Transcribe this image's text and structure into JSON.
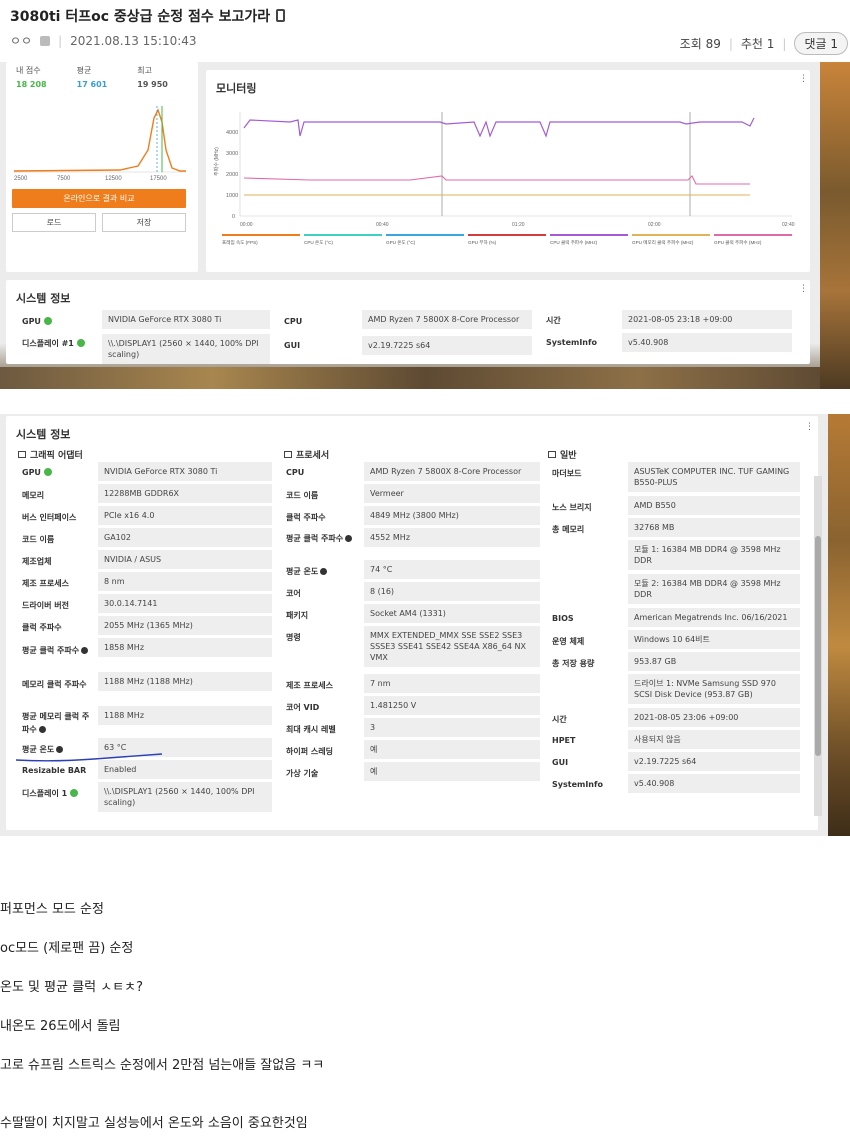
{
  "post": {
    "title": "3080ti 터프oc 중상급 순정 점수 보고가라",
    "author": "ㅇㅇ",
    "datetime": "2021.08.13 15:10:43",
    "views": "조회 89",
    "likes": "추천 1",
    "comments": "댓글 1"
  },
  "shot1": {
    "score_labels": [
      "내 점수",
      "평균",
      "최고"
    ],
    "score_values": [
      "18 208",
      "17 601",
      "19 950"
    ],
    "score_colors": [
      "#49b649",
      "#3a9bd9",
      "#222222"
    ],
    "hist_ticks": [
      "2500",
      "7500",
      "12500",
      "17500"
    ],
    "compare_button": "온라인으로 결과 비교",
    "load_button": "로드",
    "save_button": "저장",
    "monitoring_title": "모니터링",
    "y_axis_label": "주파수 (MHz)",
    "y_ticks": [
      "4000",
      "3000",
      "2000",
      "1000",
      "0"
    ],
    "x_ticks": [
      "00:00",
      "00:40",
      "01:20",
      "02:00",
      "02:40"
    ],
    "legend": [
      {
        "label": "프레임 속도 (FPS)",
        "color": "#f07d1c"
      },
      {
        "label": "CPU 온도 (°C)",
        "color": "#3ed0c5"
      },
      {
        "label": "GPU 온도 (°C)",
        "color": "#3aa6e0"
      },
      {
        "label": "GPU 부하 (%)",
        "color": "#d23c3c"
      },
      {
        "label": "CPU 클럭 주파수 (MHz)",
        "color": "#a35cd6"
      },
      {
        "label": "GPU 메모리 클럭 주파수 (MHz)",
        "color": "#e0b25a"
      },
      {
        "label": "GPU 클럭 주파수 (MHz)",
        "color": "#e06aa8"
      }
    ],
    "sys_title": "시스템 정보",
    "rows": [
      {
        "label": "GPU",
        "value": "NVIDIA GeForce RTX 3080 Ti"
      },
      {
        "label": "디스플레이 #1",
        "value": "\\\\.\\DISPLAY1 (2560 × 1440, 100% DPI scaling)"
      },
      {
        "label": "CPU",
        "value": "AMD Ryzen 7 5800X 8-Core Processor"
      },
      {
        "label": "GUI",
        "value": "v2.19.7225 s64"
      },
      {
        "label": "시간",
        "value": "2021-08-05 23:18 +09:00"
      },
      {
        "label": "SystemInfo",
        "value": "v5.40.908"
      }
    ]
  },
  "shot2": {
    "title": "시스템 정보",
    "gpu_head": "그래픽 어댑터",
    "cpu_head": "프로세서",
    "gen_head": "일반",
    "gpu_rows": [
      {
        "label": "GPU",
        "value": "NVIDIA GeForce RTX 3080 Ti"
      },
      {
        "label": "메모리",
        "value": "12288MB GDDR6X"
      },
      {
        "label": "버스 인터페이스",
        "value": "PCIe x16 4.0"
      },
      {
        "label": "코드 이름",
        "value": "GA102"
      },
      {
        "label": "제조업체",
        "value": "NVIDIA / ASUS"
      },
      {
        "label": "제조 프로세스",
        "value": "8 nm"
      },
      {
        "label": "드라이버 버전",
        "value": "30.0.14.7141"
      },
      {
        "label": "클럭 주파수",
        "value": "2055 MHz (1365 MHz)"
      },
      {
        "label": "평균 클럭 주파수",
        "value": "1858 MHz"
      },
      {
        "label": "메모리 클럭 주파수",
        "value": "1188 MHz (1188 MHz)"
      },
      {
        "label": "평균 메모리 클럭 주파수",
        "value": "1188 MHz"
      },
      {
        "label": "평균 온도",
        "value": "63 °C"
      },
      {
        "label": "Resizable BAR",
        "value": "Enabled"
      },
      {
        "label": "디스플레이 1",
        "value": "\\\\.\\DISPLAY1 (2560 × 1440, 100% DPI scaling)"
      }
    ],
    "cpu_rows": [
      {
        "label": "CPU",
        "value": "AMD Ryzen 7 5800X 8-Core Processor"
      },
      {
        "label": "코드 이름",
        "value": "Vermeer"
      },
      {
        "label": "클럭 주파수",
        "value": "4849 MHz (3800 MHz)"
      },
      {
        "label": "평균 클럭 주파수",
        "value": "4552 MHz"
      },
      {
        "label": "평균 온도",
        "value": "74 °C"
      },
      {
        "label": "코어",
        "value": "8 (16)"
      },
      {
        "label": "패키지",
        "value": "Socket AM4 (1331)"
      },
      {
        "label": "명령",
        "value": "MMX EXTENDED_MMX SSE SSE2 SSE3 SSSE3 SSE41 SSE42 SSE4A X86_64 NX VMX"
      },
      {
        "label": "제조 프로세스",
        "value": "7 nm"
      },
      {
        "label": "코어 VID",
        "value": "1.481250 V"
      },
      {
        "label": "최대 캐시 레벨",
        "value": "3"
      },
      {
        "label": "하이퍼 스레딩",
        "value": "예"
      },
      {
        "label": "가상 기술",
        "value": "예"
      }
    ],
    "gen_rows": [
      {
        "label": "마더보드",
        "value": "ASUSTeK COMPUTER INC. TUF GAMING B550-PLUS"
      },
      {
        "label": "노스 브리지",
        "value": "AMD B550"
      },
      {
        "label": "총 메모리",
        "value": "32768 MB"
      },
      {
        "label": "",
        "value": "모듈 1: 16384 MB DDR4 @ 3598 MHz DDR"
      },
      {
        "label": "",
        "value": "모듈 2: 16384 MB DDR4 @ 3598 MHz DDR"
      },
      {
        "label": "BIOS",
        "value": "American Megatrends Inc. 06/16/2021"
      },
      {
        "label": "운영 체제",
        "value": "Windows 10 64비트"
      },
      {
        "label": "총 저장 용량",
        "value": "953.87 GB"
      },
      {
        "label": "",
        "value": "드라이브 1: NVMe Samsung SSD 970 SCSI Disk Device (953.87 GB)"
      },
      {
        "label": "시간",
        "value": "2021-08-05 23:06 +09:00"
      },
      {
        "label": "HPET",
        "value": "사용되지 않음"
      },
      {
        "label": "GUI",
        "value": "v2.19.7225 s64"
      },
      {
        "label": "SystemInfo",
        "value": "v5.40.908"
      }
    ]
  },
  "body_lines": [
    "퍼포먼스 모드 순정",
    "oc모드 (제로팬 끔) 순정",
    "온도 및 평균 클럭 ㅅㅌㅊ?",
    "내온도 26도에서 돌림",
    "고로 슈프림 스트릭스 순정에서 2만점 넘는애들 잘없음 ㅋㅋ",
    "수딸딸이 치지말고 실성능에서 온도와 소음이 중요한것임"
  ]
}
